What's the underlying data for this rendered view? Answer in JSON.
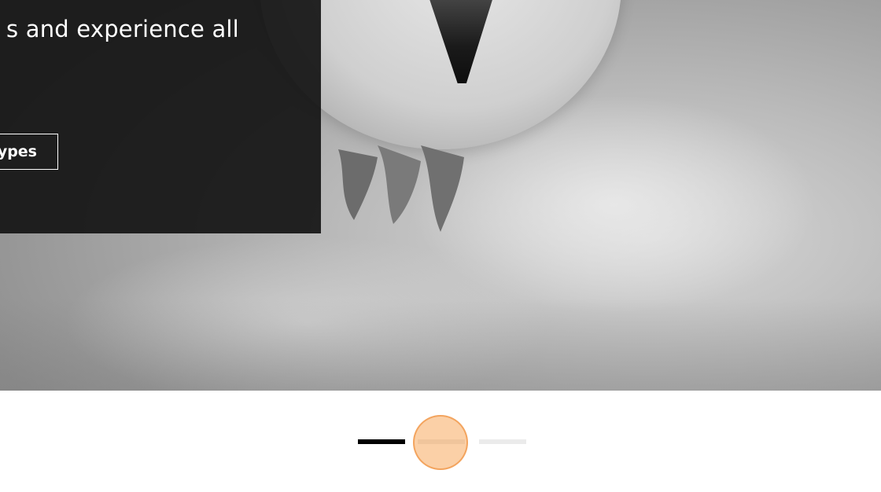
{
  "hero": {
    "panel_text": "s and experience all",
    "cta_label": "ypes"
  },
  "carousel": {
    "slide_count": 3,
    "active_index": 0,
    "indicators": [
      "slide-1",
      "slide-2",
      "slide-3"
    ]
  },
  "colors": {
    "panel_bg": "#141414",
    "indicator_active": "#000000",
    "indicator_inactive": "#ebebeb",
    "touch_marker": "#f7aa5f"
  }
}
